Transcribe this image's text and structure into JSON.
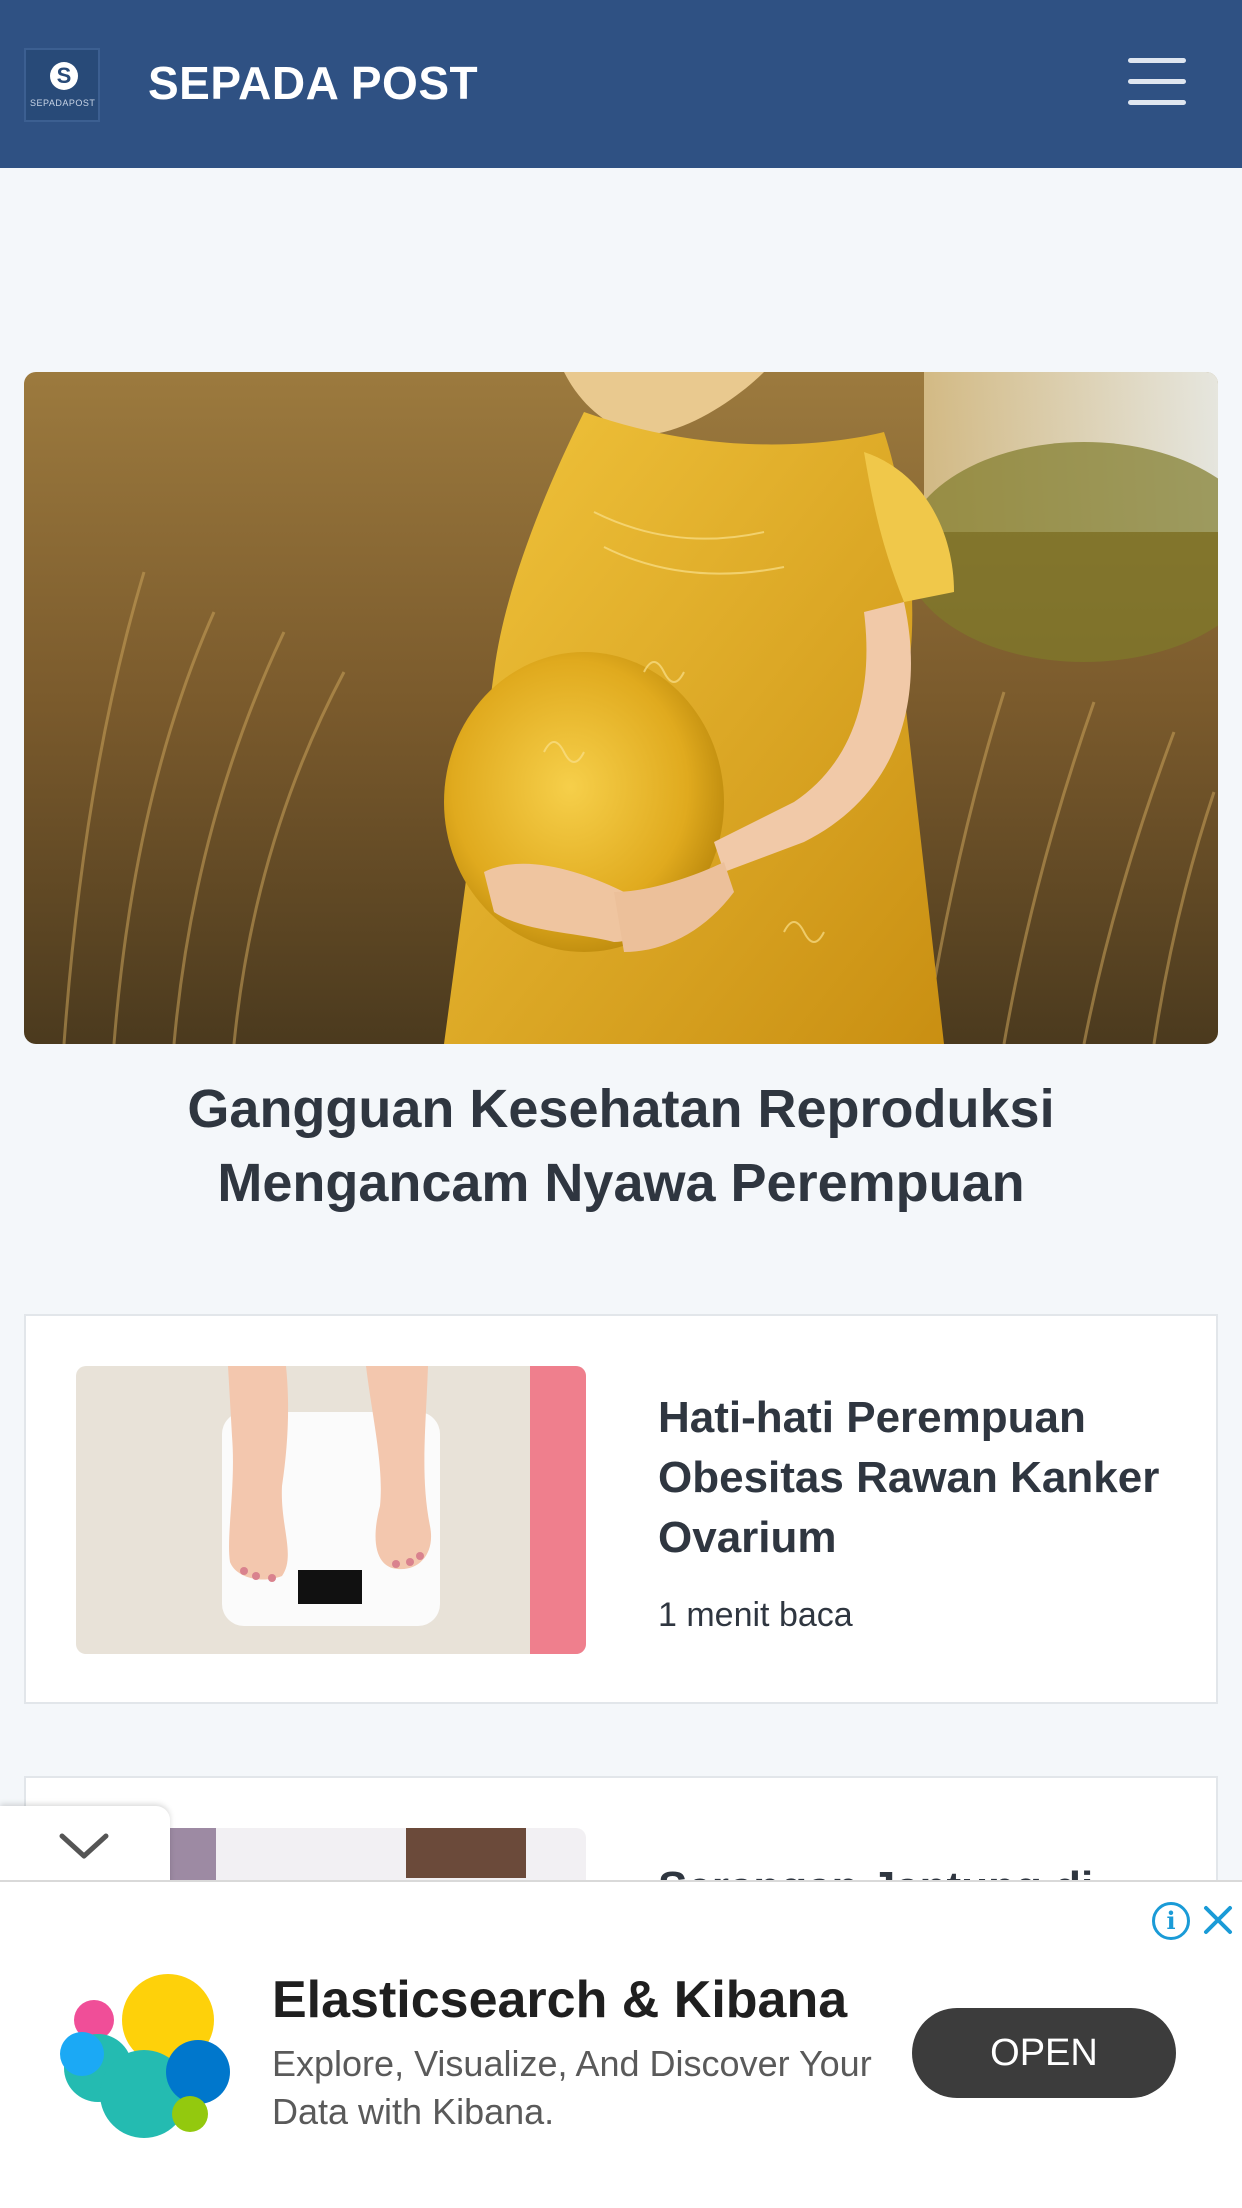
{
  "header": {
    "logo_text": "SEPADAPOST",
    "logo_mark": "S",
    "site_title": "SEPADA POST",
    "menu_icon": "hamburger-menu-icon"
  },
  "hero": {
    "title": "Gangguan Kesehatan Reproduksi Mengancam Nyawa Perempuan"
  },
  "articles": [
    {
      "title": "Hati-hati Perempuan Obesitas Rawan Kanker Ovarium",
      "meta": "1 menit baca"
    },
    {
      "title": "Serangan Jantung di"
    }
  ],
  "collapse": {
    "icon": "chevron-down-icon"
  },
  "ad": {
    "title": "Elasticsearch & Kibana",
    "description": "Explore, Visualize, And Discover Your Data with Kibana.",
    "button_label": "OPEN",
    "info_icon": "info-icon",
    "close_icon": "close-icon",
    "info_glyph": "i"
  },
  "colors": {
    "header_bg": "#2f5183",
    "page_bg": "#f4f7fa",
    "text": "#2f3640",
    "ad_button_bg": "#3c3c3c",
    "ad_icon": "#1a9bd7"
  }
}
